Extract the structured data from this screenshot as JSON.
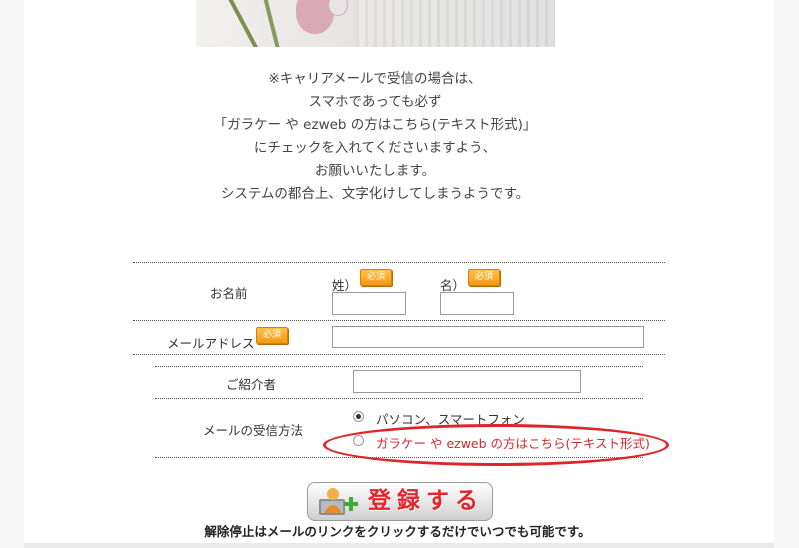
{
  "notice": {
    "lines": [
      "※キャリアメールで受信の場合は、",
      "スマホであっても必ず",
      "「ガラケー や ezweb の方はこちら(テキスト形式)」",
      "にチェックを入れてくださいますよう、",
      "お願いいたします。",
      "システムの都合上、文字化けしてしまうようです。"
    ]
  },
  "form": {
    "required_badge": "必須",
    "name": {
      "label": "お名前",
      "last_label": "姓）",
      "first_label": "名）",
      "last_value": "",
      "first_value": ""
    },
    "email": {
      "label": "メールアドレス",
      "value": ""
    },
    "referrer": {
      "label": "ご紹介者",
      "value": ""
    },
    "mail_method": {
      "label": "メールの受信方法",
      "options": [
        {
          "label": "パソコン、スマートフォン",
          "selected": true
        },
        {
          "label": "ガラケー や ezweb の方はこちら(テキスト形式)",
          "selected": false
        }
      ]
    },
    "submit_label": "登録する"
  },
  "footer_note": "解除停止はメールのリンクをクリックするだけでいつでも可能です。",
  "colors": {
    "highlight": "#e0252a",
    "required_badge": "#f29a12",
    "submit_text": "#e3262b"
  },
  "icons": {
    "submit": "person-add-icon"
  }
}
